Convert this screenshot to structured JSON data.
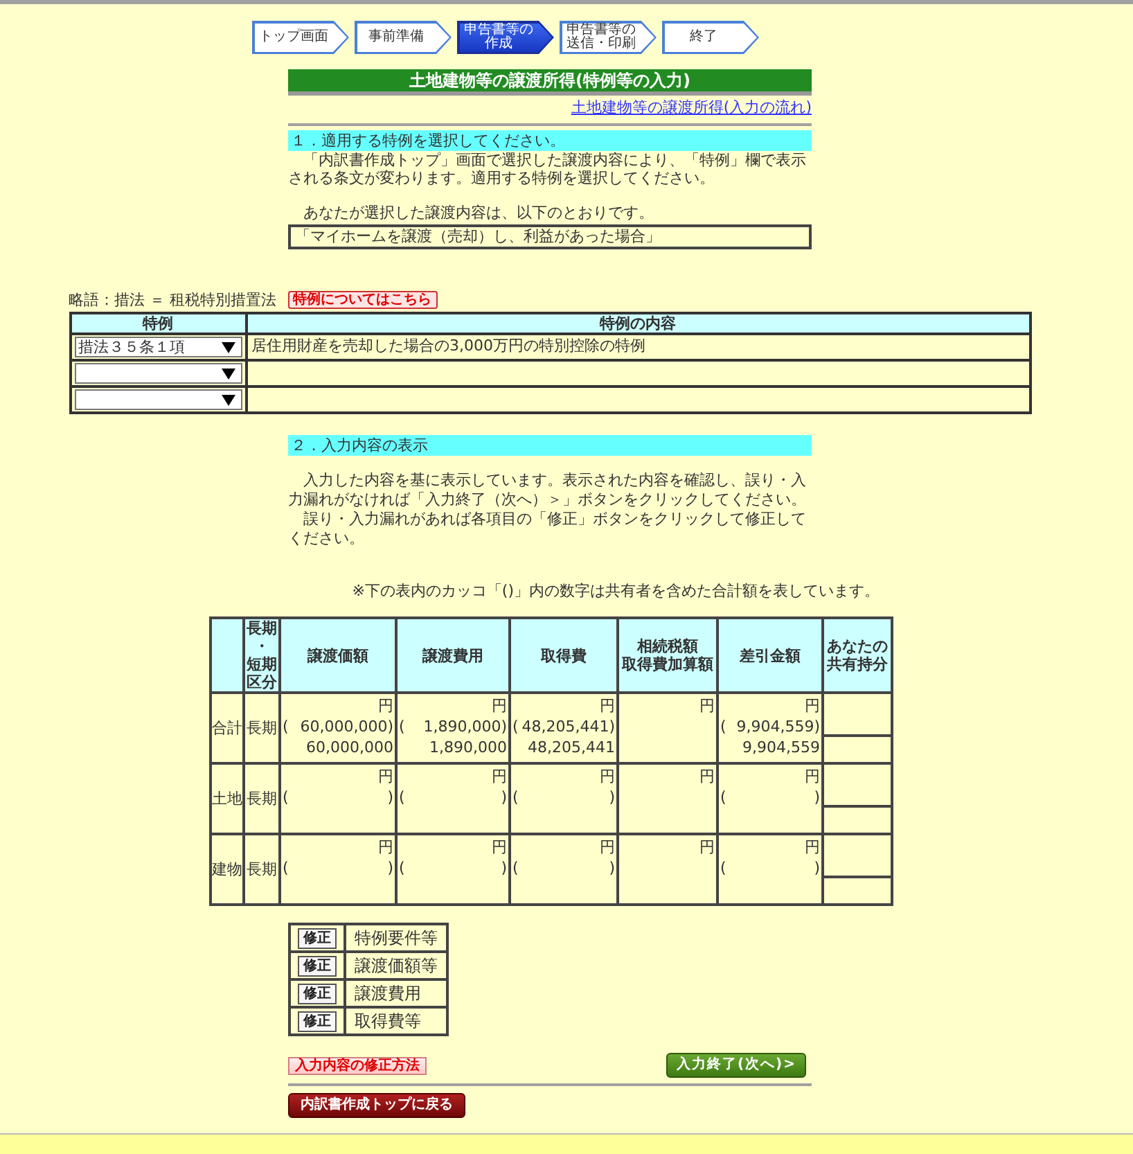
{
  "steps": [
    {
      "label": "トップ画面",
      "selected": false
    },
    {
      "label": "事前準備",
      "selected": false
    },
    {
      "label": "申告書等の作成",
      "selected": true
    },
    {
      "label": "申告書等の送信・印刷",
      "selected": false
    },
    {
      "label": "終了",
      "selected": false
    }
  ],
  "title": "土地建物等の譲渡所得(特例等の入力)",
  "flow_link": "土地建物等の譲渡所得(入力の流れ)",
  "section_1": {
    "heading": "１．適用する特例を選択してください。",
    "paragraph": "「内訳書作成トップ」画面で選択した譲渡内容により、「特例」欄で表示される条文が変わります。適用する特例を選択してください。",
    "intro": "あなたが選択した譲渡内容は、以下のとおりです。",
    "selected_transfer": "「マイホームを譲渡（売却）し、利益があった場合」"
  },
  "abbreviation": "略語：措法 ＝ 租税特別措置法",
  "special_rules_button": "特例についてはこちら",
  "special_rules_table": {
    "columns": [
      "特例",
      "特例の内容"
    ],
    "rows": [
      {
        "kind": "chosen",
        "rule": "措法３５条１項",
        "content": "居住用財産を売却した場合の3,000万円の特別控除の特例"
      },
      {
        "kind": "blank"
      },
      {
        "kind": "blank"
      }
    ]
  },
  "section_2": {
    "heading": "２．入力内容の表示",
    "paragraphs": [
      "入力した内容を基に表示しています。表示された内容を確認し、誤り・入力漏れがなければ「入力終了（次へ）＞」ボタンをクリックしてください。",
      "誤り・入力漏れがあれば各項目の「修正」ボタンをクリックして修正してください。"
    ],
    "note": "※下の表内のカッコ「()」内の数字は共有者を含めた合計額を表しています。"
  },
  "summary_table": {
    "columns": [
      "",
      "長期・短期区分",
      "譲渡価額",
      "譲渡費用",
      "取得費",
      "相続税額取得費加算額",
      "差引金額",
      "あなたの共有持分"
    ],
    "rows": [
      {
        "cells": [
          {
            "kind": "label",
            "text": "合計"
          },
          {
            "kind": "term",
            "text": "長期"
          },
          {
            "kind": "amount",
            "unit": "円",
            "coowner": {
              "open": "(",
              "amount": "60,000,000",
              "close": ")"
            },
            "amount": "60,000,000"
          },
          {
            "kind": "amount",
            "unit": "円",
            "coowner": {
              "open": "(",
              "amount": "1,890,000",
              "close": ")"
            },
            "amount": "1,890,000"
          },
          {
            "kind": "amount",
            "unit": "円",
            "coowner": {
              "open": "(",
              "amount": "48,205,441",
              "close": ")"
            },
            "amount": "48,205,441"
          },
          {
            "kind": "amount",
            "unit": "円"
          },
          {
            "kind": "amount",
            "unit": "円",
            "coowner": {
              "open": "(",
              "amount": "9,904,559",
              "close": ")"
            },
            "amount": "9,904,559"
          }
        ]
      },
      {
        "cells": [
          {
            "kind": "label",
            "text": "土地"
          },
          {
            "kind": "term",
            "text": "長期"
          },
          {
            "kind": "amount",
            "unit": "円",
            "coowner": {
              "open": "(",
              "close": ")"
            }
          },
          {
            "kind": "amount",
            "unit": "円",
            "coowner": {
              "open": "(",
              "close": ")"
            }
          },
          {
            "kind": "amount",
            "unit": "円",
            "coowner": {
              "open": "(",
              "close": ")"
            }
          },
          {
            "kind": "amount",
            "unit": "円"
          },
          {
            "kind": "amount",
            "unit": "円",
            "coowner": {
              "open": "(",
              "close": ")"
            }
          }
        ]
      },
      {
        "cells": [
          {
            "kind": "label",
            "text": "建物"
          },
          {
            "kind": "term",
            "text": "長期"
          },
          {
            "kind": "amount",
            "unit": "円",
            "coowner": {
              "open": "(",
              "close": ")"
            }
          },
          {
            "kind": "amount",
            "unit": "円",
            "coowner": {
              "open": "(",
              "close": ")"
            }
          },
          {
            "kind": "amount",
            "unit": "円",
            "coowner": {
              "open": "(",
              "close": ")"
            }
          },
          {
            "kind": "amount",
            "unit": "円"
          },
          {
            "kind": "amount",
            "unit": "円",
            "coowner": {
              "open": "(",
              "close": ")"
            }
          }
        ]
      }
    ]
  },
  "fix_items": [
    {
      "button": "修正",
      "label": "特例要件等"
    },
    {
      "button": "修正",
      "label": "譲渡価額等"
    },
    {
      "button": "修正",
      "label": "譲渡費用"
    },
    {
      "button": "修正",
      "label": "取得費等"
    }
  ],
  "fix_method_button": "入力内容の修正方法",
  "next_button": "入力終了(次へ)>",
  "back_button": "内訳書作成トップに戻る"
}
